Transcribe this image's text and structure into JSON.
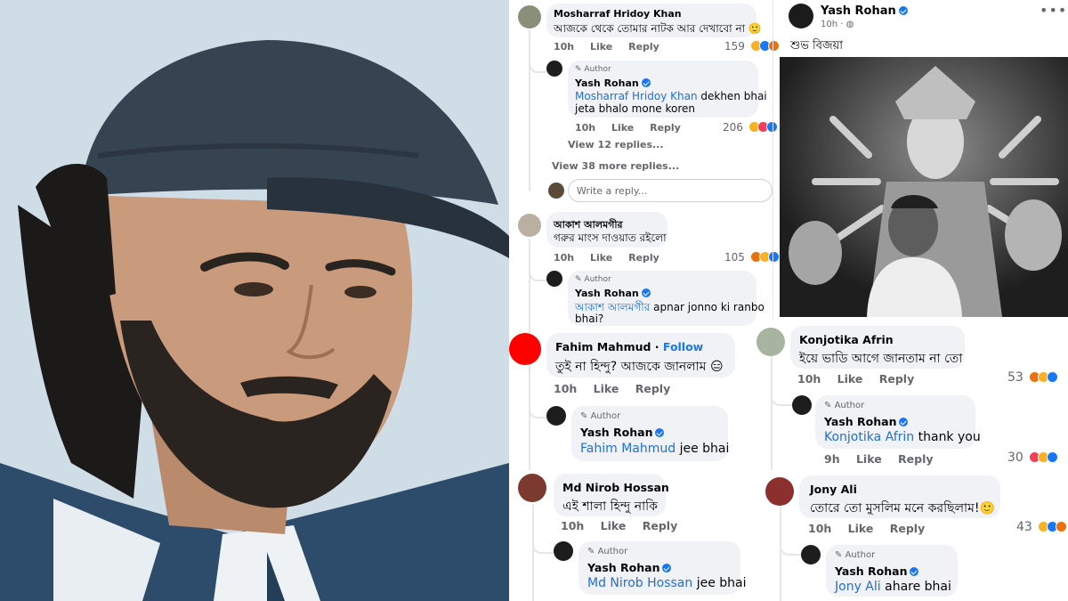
{
  "post": {
    "author": "Yash Rohan",
    "time": "10h",
    "caption": "শুভ বিজয়া",
    "more": "•••"
  },
  "author_tag": "Author",
  "reply_box_placeholder": "Write a reply...",
  "colors": {
    "accent": "#1877f2",
    "bubble": "#f0f2f5",
    "meta": "#65676b",
    "mention": "#216fdb"
  },
  "left_column": [
    {
      "name": "Mosharraf Hridoy Khan",
      "text": "আজকে থেকে তোমার নাটক আর দেখাবো না 🙂",
      "time": "10h",
      "like": "Like",
      "reply": "Reply",
      "count": "159",
      "author_reply": {
        "name": "Yash Rohan",
        "mention": "Mosharraf Hridoy Khan",
        "text_line1": " dekhen bhai",
        "text_line2": "jeta bhalo mone koren",
        "time": "10h",
        "like": "Like",
        "reply": "Reply",
        "count": "206"
      },
      "view_replies": "View 12 replies...",
      "view_more": "View 38 more replies..."
    },
    {
      "name": "আকাশ আলমগীর",
      "text": "গরুর মাংস দাওয়াত রইলো",
      "time": "10h",
      "like": "Like",
      "reply": "Reply",
      "count": "105",
      "author_reply": {
        "name": "Yash Rohan",
        "mention": "আকাশ আলমগীর",
        "text_line1": " apnar jonno ki ranbo",
        "text_line2": "bhai?"
      }
    },
    {
      "name": "Fahim Mahmud",
      "follow": "Follow",
      "text": "তুই না হিন্দু? আজকে জানলাম 😑",
      "time": "10h",
      "like": "Like",
      "reply": "Reply",
      "author_reply": {
        "name": "Yash Rohan",
        "mention": "Fahim Mahmud",
        "text": " jee bhai"
      }
    },
    {
      "name": "Md Nirob Hossan",
      "text": "এই শালা হিন্দু নাকি",
      "time": "10h",
      "like": "Like",
      "reply": "Reply",
      "author_reply": {
        "name": "Yash Rohan",
        "mention": "Md Nirob Hossan",
        "text": " jee bhai"
      }
    }
  ],
  "right_column": [
    {
      "name": "Konjotika Afrin",
      "text": "ইয়ে ভাডি আগে জানতাম না তো",
      "time": "10h",
      "like": "Like",
      "reply": "Reply",
      "count": "53",
      "author_reply": {
        "name": "Yash Rohan",
        "mention": "Konjotika Afrin",
        "text": " thank you",
        "time": "9h",
        "like": "Like",
        "reply": "Reply",
        "count": "30"
      }
    },
    {
      "name": "Jony  Ali",
      "text": "তোরে তো মুসলিম মনে করছিলাম!🙂",
      "time": "10h",
      "like": "Like",
      "reply": "Reply",
      "count": "43",
      "author_reply": {
        "name": "Yash Rohan",
        "mention": "Jony  Ali",
        "text": " ahare bhai"
      }
    }
  ]
}
